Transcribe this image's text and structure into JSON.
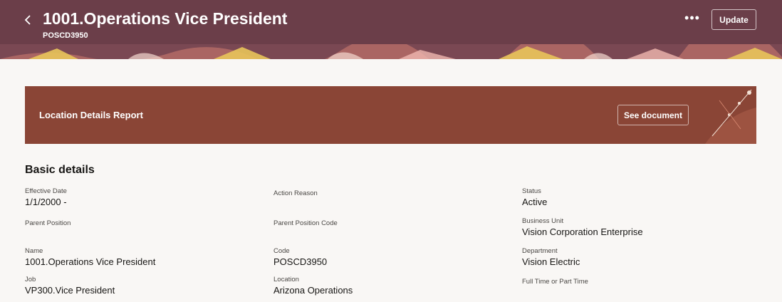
{
  "header": {
    "title": "1001.Operations Vice President",
    "subtitle": "POSCD3950",
    "back_icon": "chevron-left-icon",
    "more_icon": "more-horizontal-icon",
    "more_glyph": "•••",
    "update_label": "Update",
    "color": "#6b3e49"
  },
  "banner": {
    "title": "Location Details Report",
    "button_label": "See document",
    "color": "#8a4536"
  },
  "basic_details": {
    "heading": "Basic details",
    "fields": {
      "effective_date": {
        "label": "Effective Date",
        "value": "1/1/2000 -"
      },
      "action_reason": {
        "label": "Action Reason",
        "value": ""
      },
      "status": {
        "label": "Status",
        "value": "Active"
      },
      "parent_position": {
        "label": "Parent Position",
        "value": ""
      },
      "parent_position_code": {
        "label": "Parent Position Code",
        "value": ""
      },
      "business_unit": {
        "label": "Business Unit",
        "value": "Vision Corporation Enterprise"
      },
      "name": {
        "label": "Name",
        "value": "1001.Operations Vice President"
      },
      "code": {
        "label": "Code",
        "value": "POSCD3950"
      },
      "department": {
        "label": "Department",
        "value": "Vision Electric"
      },
      "job": {
        "label": "Job",
        "value": "VP300.Vice President"
      },
      "location": {
        "label": "Location",
        "value": "Arizona Operations"
      },
      "full_time_part_time": {
        "label": "Full Time or Part Time",
        "value": ""
      }
    }
  }
}
